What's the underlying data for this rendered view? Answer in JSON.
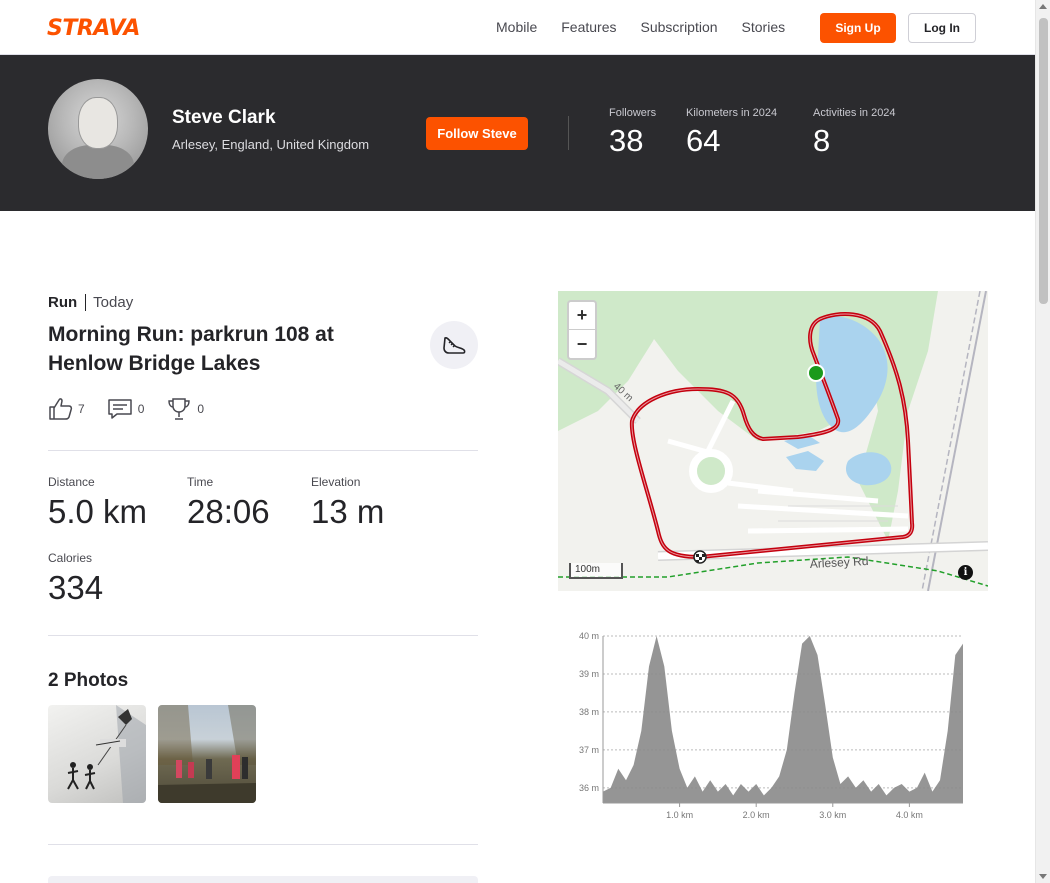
{
  "brand": {
    "logo_text": "STRAVA",
    "accent": "#fc5200"
  },
  "nav": {
    "links": [
      "Mobile",
      "Features",
      "Subscription",
      "Stories"
    ],
    "signup_label": "Sign Up",
    "login_label": "Log In"
  },
  "profile": {
    "name": "Steve Clark",
    "location": "Arlesey, England, United Kingdom",
    "follow_label": "Follow Steve",
    "stats": [
      {
        "label": "Followers",
        "value": "38"
      },
      {
        "label": "Kilometers in 2024",
        "value": "64"
      },
      {
        "label": "Activities in 2024",
        "value": "8"
      }
    ]
  },
  "activity": {
    "type": "Run",
    "when": "Today",
    "title": "Morning Run: parkrun 108 at Henlow Bridge Lakes",
    "kudos": "7",
    "comments": "0",
    "achievements": "0",
    "metrics": {
      "distance": {
        "label": "Distance",
        "value": "5.0 km"
      },
      "time": {
        "label": "Time",
        "value": "28:06"
      },
      "elevation": {
        "label": "Elevation",
        "value": "13 m"
      },
      "calories": {
        "label": "Calories",
        "value": "334"
      }
    },
    "photos_title": "2 Photos"
  },
  "map": {
    "zoom_in": "+",
    "zoom_out": "−",
    "scale_label": "100m",
    "road_label": "Arlesey Rd",
    "road_label_2": "40 m",
    "info_label": "i"
  },
  "chart_data": {
    "type": "area",
    "title": "",
    "xlabel": "",
    "ylabel": "",
    "x_ticks": [
      "1.0 km",
      "2.0 km",
      "3.0 km",
      "4.0 km"
    ],
    "y_ticks": [
      "40 m",
      "39 m",
      "38 m",
      "37 m",
      "36 m"
    ],
    "xlim": [
      0,
      4.7
    ],
    "ylim": [
      35.6,
      40
    ],
    "x": [
      0,
      0.1,
      0.2,
      0.3,
      0.4,
      0.5,
      0.6,
      0.7,
      0.8,
      0.9,
      1.0,
      1.1,
      1.2,
      1.3,
      1.4,
      1.5,
      1.6,
      1.7,
      1.8,
      1.9,
      2.0,
      2.1,
      2.2,
      2.3,
      2.4,
      2.5,
      2.6,
      2.7,
      2.8,
      2.9,
      3.0,
      3.1,
      3.2,
      3.3,
      3.4,
      3.5,
      3.6,
      3.7,
      3.8,
      3.9,
      4.0,
      4.1,
      4.2,
      4.3,
      4.4,
      4.5,
      4.6,
      4.7
    ],
    "values": [
      35.9,
      36.0,
      36.5,
      36.2,
      36.6,
      37.5,
      39.2,
      40.0,
      39.2,
      37.5,
      36.5,
      36.0,
      36.3,
      35.9,
      36.2,
      35.9,
      36.1,
      35.8,
      36.1,
      35.9,
      36.1,
      35.8,
      36.0,
      36.3,
      37.0,
      38.5,
      39.8,
      40.0,
      39.5,
      38.2,
      36.8,
      36.1,
      36.3,
      36.0,
      36.2,
      35.9,
      36.1,
      35.8,
      36.0,
      36.1,
      35.9,
      36.0,
      36.4,
      35.9,
      36.2,
      37.5,
      39.5,
      39.8
    ]
  }
}
